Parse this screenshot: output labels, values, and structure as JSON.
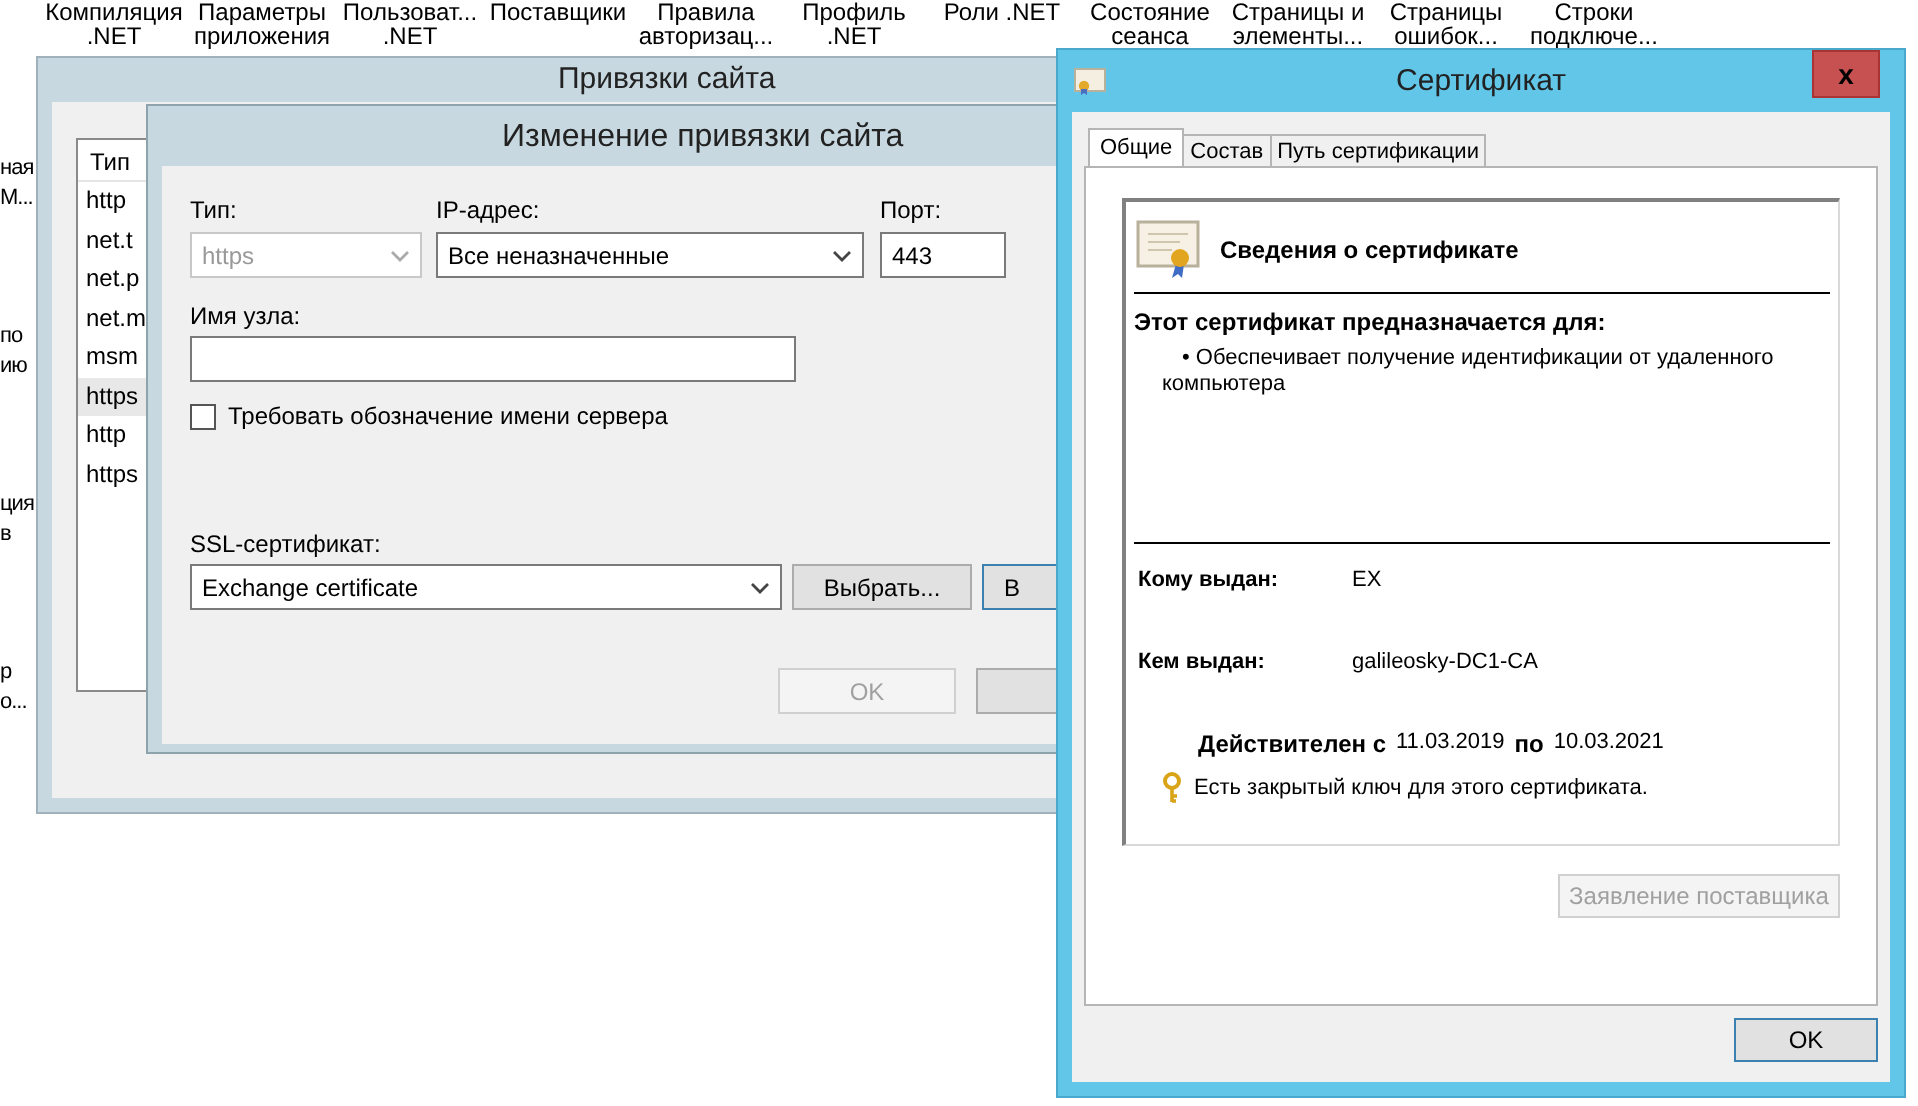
{
  "background": {
    "columns": [
      {
        "lines": [
          "Компиляция",
          ".NET"
        ]
      },
      {
        "lines": [
          "Параметры",
          "приложения"
        ]
      },
      {
        "lines": [
          "Пользоват...",
          ".NET"
        ]
      },
      {
        "lines": [
          "Поставщики"
        ]
      },
      {
        "lines": [
          "Правила",
          "авторизац..."
        ]
      },
      {
        "lines": [
          "Профиль",
          ".NET"
        ]
      },
      {
        "lines": [
          "Роли .NET"
        ]
      },
      {
        "lines": [
          "Состояние",
          "сеанса"
        ]
      },
      {
        "lines": [
          "Страницы и",
          "элементы..."
        ]
      },
      {
        "lines": [
          "Страницы",
          "ошибок..."
        ]
      },
      {
        "lines": [
          "Строки",
          "подключе..."
        ]
      }
    ],
    "side_items": [
      {
        "lines": [
          "ная",
          "М..."
        ]
      },
      {
        "lines": [
          "по",
          "ию"
        ]
      },
      {
        "lines": [
          "ция",
          "в"
        ]
      },
      {
        "lines": [
          "р",
          "о..."
        ]
      }
    ]
  },
  "bindings_window": {
    "title": "Привязки сайта",
    "list_header": "Тип",
    "rows": [
      {
        "text": "http",
        "selected": false
      },
      {
        "text": "net.t",
        "selected": false
      },
      {
        "text": "net.p",
        "selected": false
      },
      {
        "text": "net.m",
        "selected": false
      },
      {
        "text": "msm",
        "selected": false
      },
      {
        "text": "https",
        "selected": true
      },
      {
        "text": "http",
        "selected": false
      },
      {
        "text": "https",
        "selected": false
      }
    ]
  },
  "edit_dialog": {
    "title": "Изменение привязки сайта",
    "type": {
      "label": "Тип:",
      "value": "https",
      "disabled": true
    },
    "ip": {
      "label": "IP-адрес:",
      "value": "Все неназначенные"
    },
    "port": {
      "label": "Порт:",
      "value": "443"
    },
    "host": {
      "label": "Имя узла:"
    },
    "sni": {
      "label": "Требовать обозначение имени сервера",
      "checked": false
    },
    "ssl": {
      "label": "SSL-сертификат:",
      "value": "Exchange certificate"
    },
    "select_button": "Выбрать...",
    "view_button": "В",
    "ok_button": {
      "label": "OK",
      "disabled": true
    }
  },
  "certificate_window": {
    "title": "Сертификат",
    "close": "x",
    "tabs": [
      {
        "label": "Общие",
        "selected": true
      },
      {
        "label": "Состав",
        "selected": false
      },
      {
        "label": "Путь сертификации",
        "selected": false
      }
    ],
    "heading": "Сведения о сертификате",
    "purpose_title": "Этот сертификат предназначается для:",
    "purposes": [
      "• Обеспечивает получение идентификации от удаленного компьютера"
    ],
    "issued_to": {
      "label": "Кому выдан:",
      "value": "EX"
    },
    "issued_by": {
      "label": "Кем выдан:",
      "value": "galileosky-DC1-CA"
    },
    "validity": {
      "from_label": "Действителен с",
      "from": "11.03.2019",
      "to_label": "по",
      "to": "10.03.2021"
    },
    "key_note": "Есть закрытый ключ для этого сертификата.",
    "issuer_statement": {
      "label": "Заявление поставщика",
      "disabled": true
    },
    "ok_button": "OK"
  }
}
